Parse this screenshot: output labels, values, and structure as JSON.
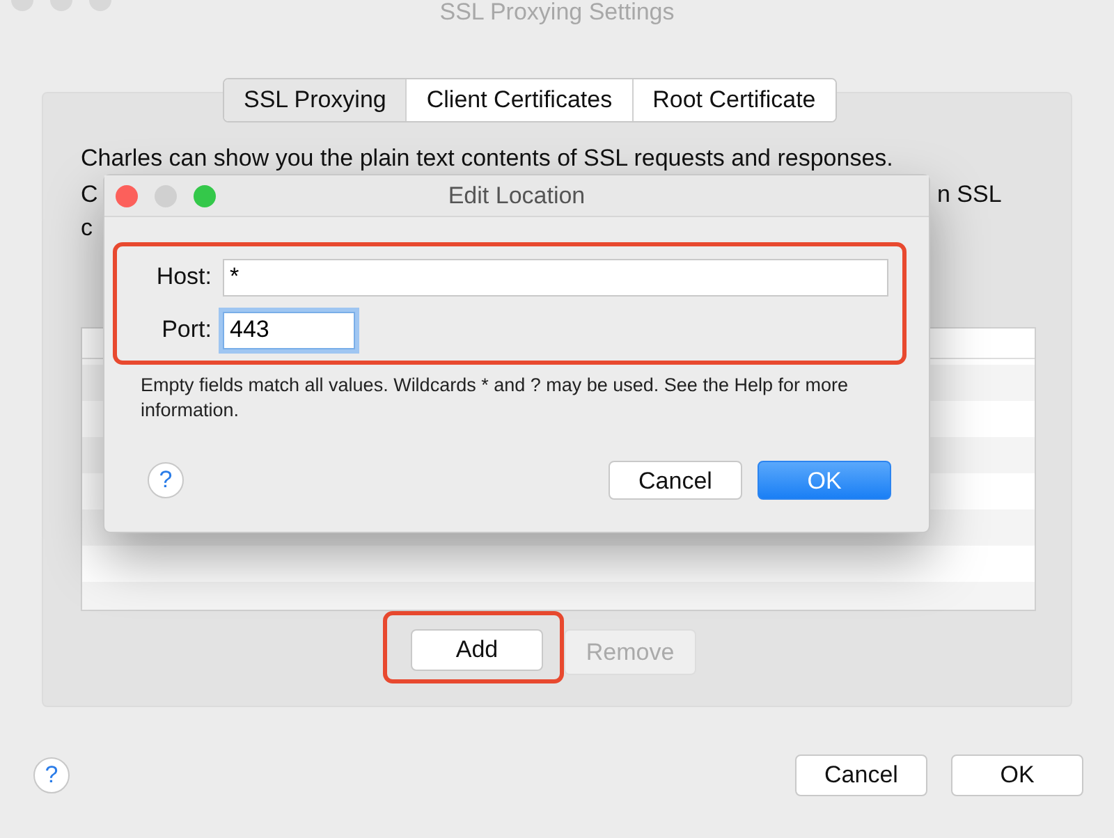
{
  "window": {
    "title": "SSL Proxying Settings"
  },
  "tabs": [
    {
      "label": "SSL Proxying",
      "selected": true
    },
    {
      "label": "Client Certificates",
      "selected": false
    },
    {
      "label": "Root Certificate",
      "selected": false
    }
  ],
  "description": {
    "line_1": "Charles can show you the plain text contents of SSL requests and responses.",
    "line_2_start": "C",
    "line_2_end": "n SSL",
    "line_3_start": "c"
  },
  "panel_buttons": [
    {
      "label": "Add",
      "disabled": false,
      "highlighted": true
    },
    {
      "label": "Remove",
      "disabled": true,
      "highlighted": false
    }
  ],
  "footer_help": "?",
  "footer_buttons": [
    {
      "label": "Cancel",
      "default": false
    },
    {
      "label": "OK",
      "default": false
    }
  ],
  "dialog": {
    "title": "Edit Location",
    "fields_highlighted": true,
    "fields": [
      {
        "label": "Host:",
        "value": "*",
        "focused": false
      },
      {
        "label": "Port:",
        "value": "443",
        "focused": true
      }
    ],
    "hint": "Empty fields match all values. Wildcards * and ? may be used. See the Help for more information.",
    "help": "?",
    "buttons": [
      {
        "label": "Cancel",
        "default": false
      },
      {
        "label": "OK",
        "default": true
      }
    ]
  }
}
